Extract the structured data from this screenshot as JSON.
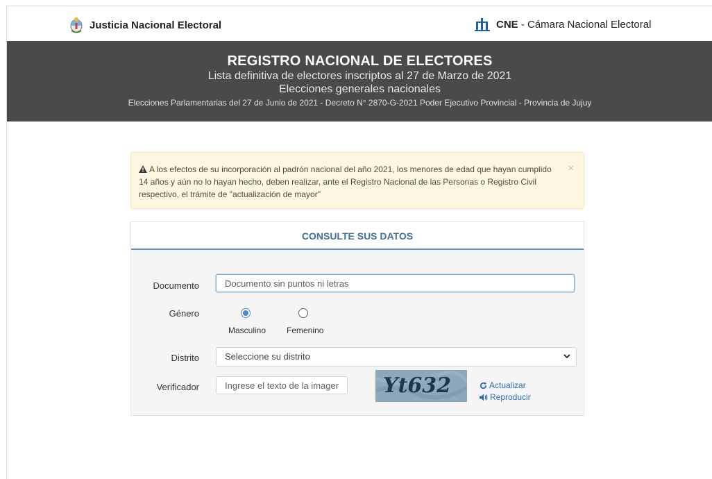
{
  "topbar": {
    "left_label": "Justicia Nacional Electoral",
    "right_label_bold": "CNE",
    "right_label_rest": " - Cámara Nacional Electoral"
  },
  "header": {
    "title": "REGISTRO NACIONAL DE ELECTORES",
    "line2": "Lista definitiva de electores inscriptos al 27 de Marzo de 2021",
    "line3": "Elecciones generales nacionales",
    "line4": "Elecciones Parlamentarias del 27 de Junio de 2021 - Decreto N° 2870-G-2021 Poder Ejecutivo Provincial - Provincia de Jujuy"
  },
  "alert": {
    "message": "A los efectos de su incorporación al padrón nacional del año 2021, los menores de edad que hayan cumplido 14 años y aún no lo hayan hecho, deben realizar, ante el Registro Nacional de las Personas o Registro Civil respectivo, el trámite de \"actualización de mayor\"",
    "close": "×"
  },
  "form": {
    "heading": "CONSULTE SUS DATOS",
    "documento": {
      "label": "Documento",
      "placeholder": "Documento sin puntos ni letras",
      "value": ""
    },
    "genero": {
      "label": "Género",
      "options": [
        {
          "label": "Masculino",
          "selected": true
        },
        {
          "label": "Femenino",
          "selected": false
        }
      ]
    },
    "distrito": {
      "label": "Distrito",
      "selected": "Seleccione su distrito"
    },
    "verificador": {
      "label": "Verificador",
      "placeholder": "Ingrese el texto de la imagen",
      "captcha_text": "Yt632",
      "refresh_label": "Actualizar",
      "audio_label": "Reproducir"
    }
  },
  "colors": {
    "header_band": "#4a4a4a",
    "accent_blue": "#3f6f9b",
    "link_blue": "#2d6db5",
    "alert_bg": "#fdf6e0"
  },
  "icons": [
    "argentina-coat-of-arms-icon",
    "cne-logo-icon",
    "warning-icon",
    "close-icon",
    "chevron-down-icon",
    "refresh-icon",
    "speaker-icon"
  ]
}
